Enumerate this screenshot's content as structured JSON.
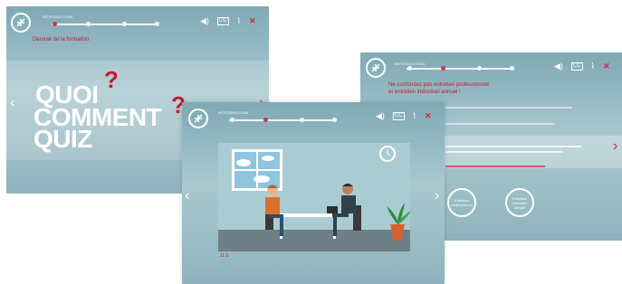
{
  "screens": {
    "left": {
      "progress_label": "INTRODUCTION",
      "subtitle": "Déroulé de la formation",
      "words": [
        "QUOI",
        "COMMENT",
        "QUIZ"
      ],
      "question_mark": "?"
    },
    "center": {
      "progress_label": "INTRODUCTION",
      "page_counter": "11 5"
    },
    "right": {
      "progress_label": "INTRODUCTION",
      "title_line1": "Ne confondez pas entretien professionnel",
      "title_line2": "et entretien individuel annuel !",
      "circle_left": "Entretien professionnel",
      "circle_right": "Entretien individuel annuel"
    }
  },
  "icons": {
    "sound": "speaker-icon",
    "captions": "captions-icon",
    "attachment": "paperclip-icon",
    "close": "close-icon"
  },
  "colors": {
    "accent": "#d7263d",
    "background": "#8fb3bd"
  }
}
